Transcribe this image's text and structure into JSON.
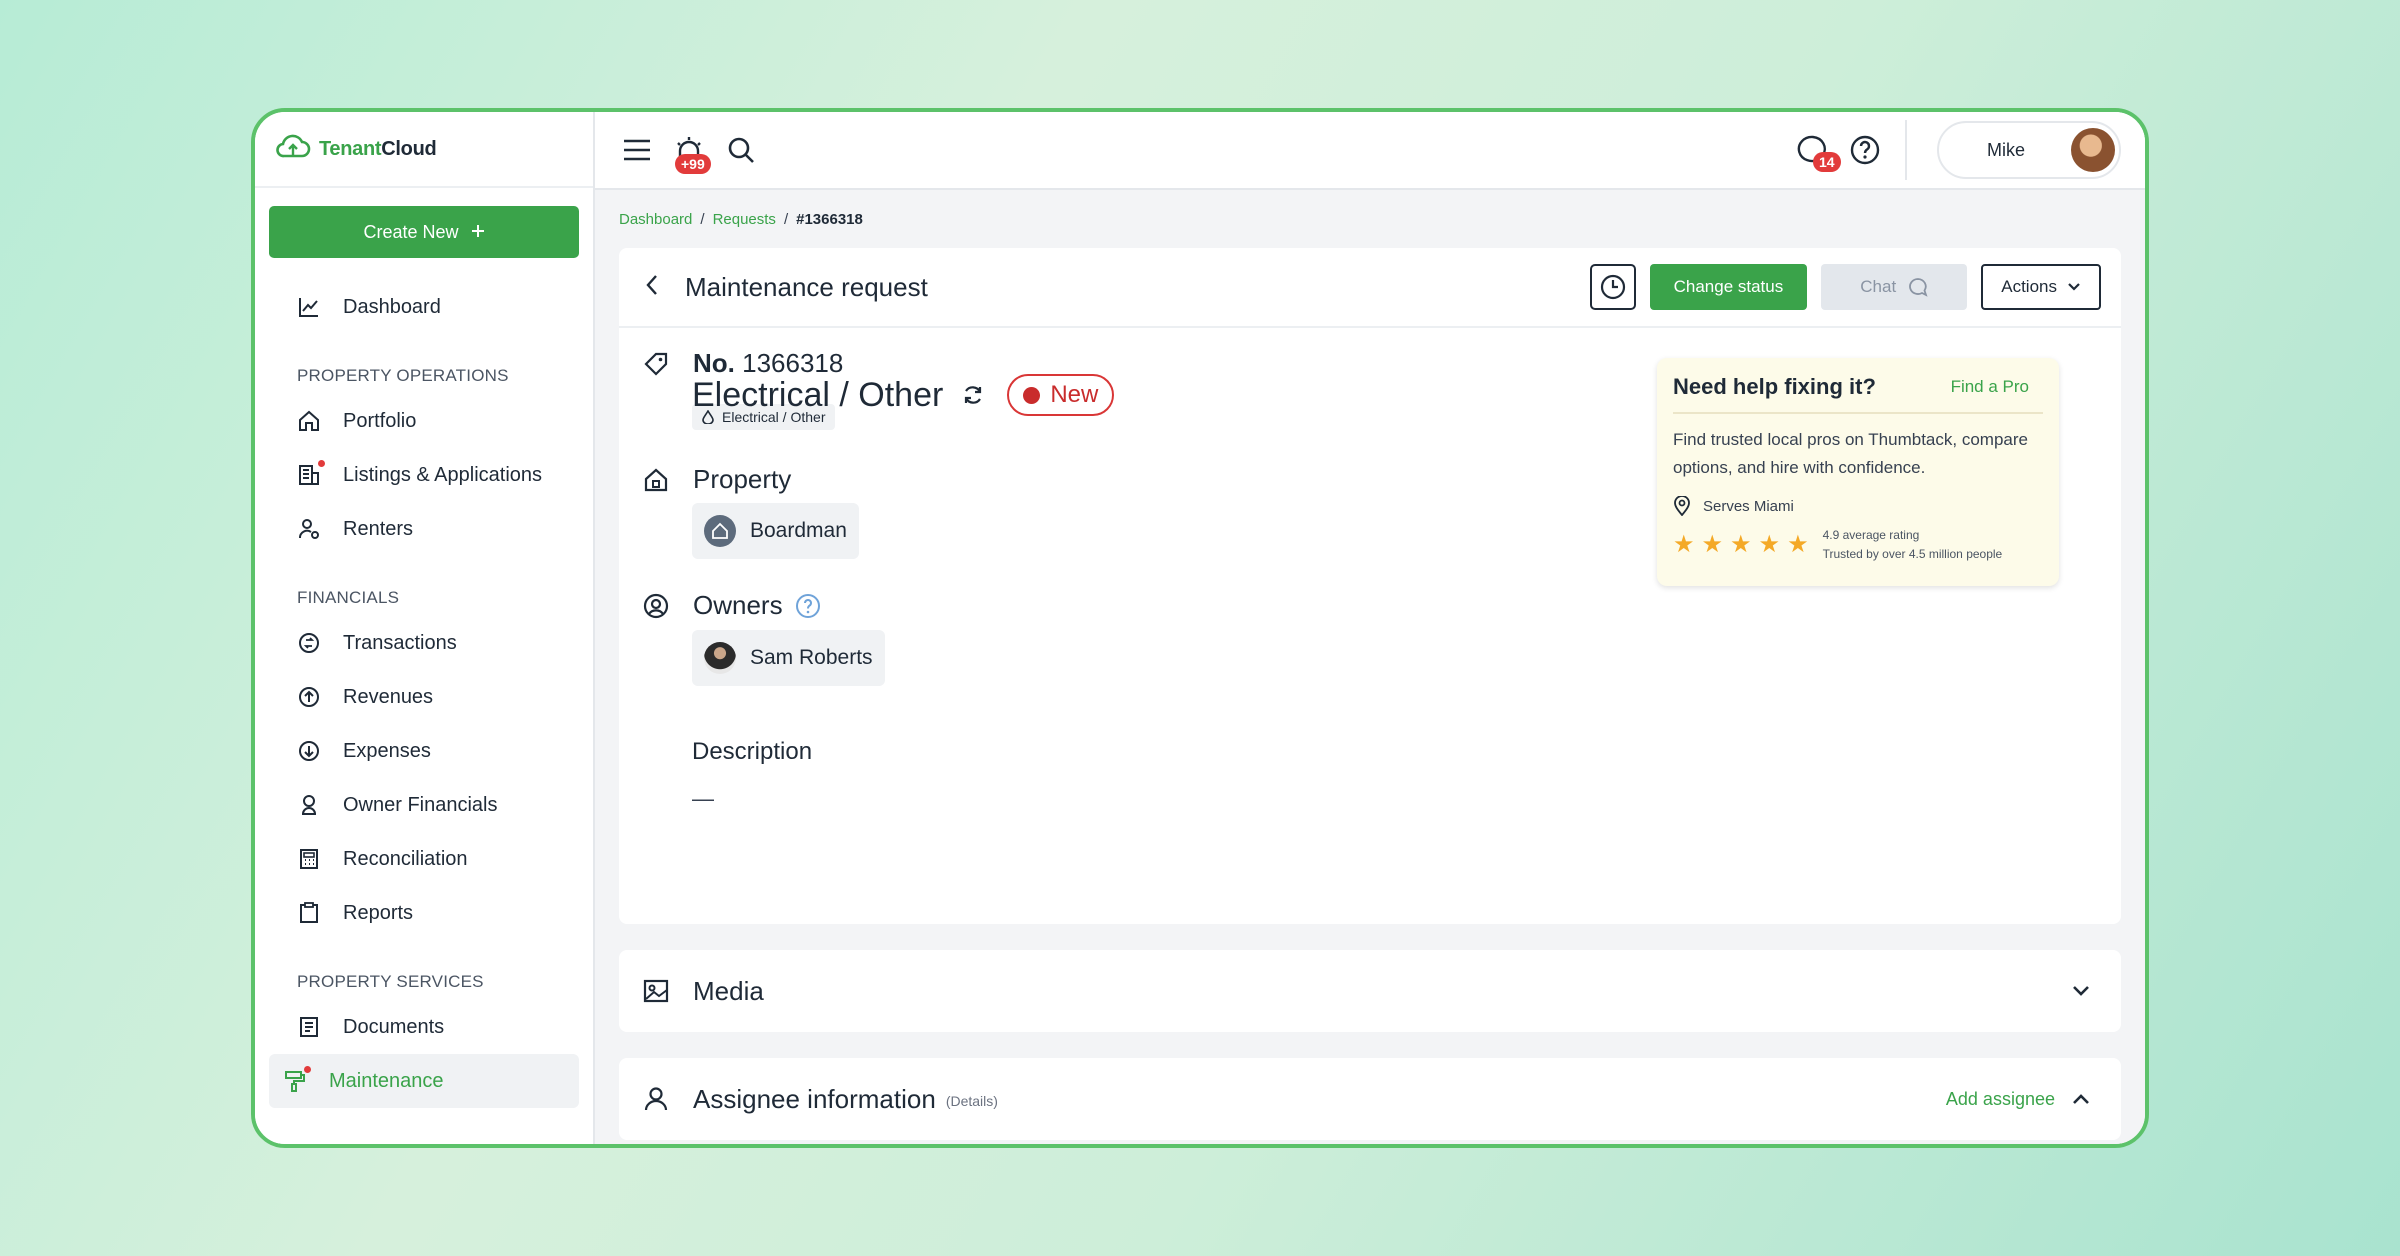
{
  "app": {
    "logo_prefix": "Tenant",
    "logo_suffix": "Cloud"
  },
  "sidebar": {
    "create_label": "Create New",
    "dashboard": "Dashboard",
    "sections": {
      "property_operations": "PROPERTY OPERATIONS",
      "financials": "FINANCIALS",
      "property_services": "PROPERTY SERVICES"
    },
    "items": {
      "portfolio": "Portfolio",
      "listings": "Listings & Applications",
      "renters": "Renters",
      "transactions": "Transactions",
      "revenues": "Revenues",
      "expenses": "Expenses",
      "owner_financials": "Owner Financials",
      "reconciliation": "Reconciliation",
      "reports": "Reports",
      "documents": "Documents",
      "maintenance": "Maintenance"
    }
  },
  "topbar": {
    "alerts_badge": "+99",
    "messages_badge": "14",
    "user_name": "Mike"
  },
  "breadcrumb": {
    "dashboard": "Dashboard",
    "requests": "Requests",
    "current": "#1366318",
    "sep": "/"
  },
  "request": {
    "header_title": "Maintenance request",
    "change_status": "Change status",
    "chat": "Chat",
    "actions": "Actions",
    "number_label": "No.",
    "number_value": "1366318",
    "category_tag": "Electrical / Other",
    "category_title": "Electrical / Other",
    "status": "New",
    "property_label": "Property",
    "property_name": "Boardman",
    "owners_label": "Owners",
    "owner_name": "Sam Roberts",
    "description_label": "Description",
    "description_value": "—"
  },
  "promo": {
    "title": "Need help fixing it?",
    "link": "Find a Pro",
    "desc": "Find trusted local pros on Thumbtack, compare options, and hire with confidence.",
    "location": "Serves Miami",
    "rating_line1": "4.9 average rating",
    "rating_line2": "Trusted by over 4.5 million people",
    "stars": 5
  },
  "media": {
    "label": "Media"
  },
  "assignee": {
    "label": "Assignee information",
    "details": "(Details)",
    "add": "Add assignee"
  },
  "colors": {
    "brand_green": "#3aa34a",
    "status_red": "#d93636",
    "star": "#f4a927"
  }
}
